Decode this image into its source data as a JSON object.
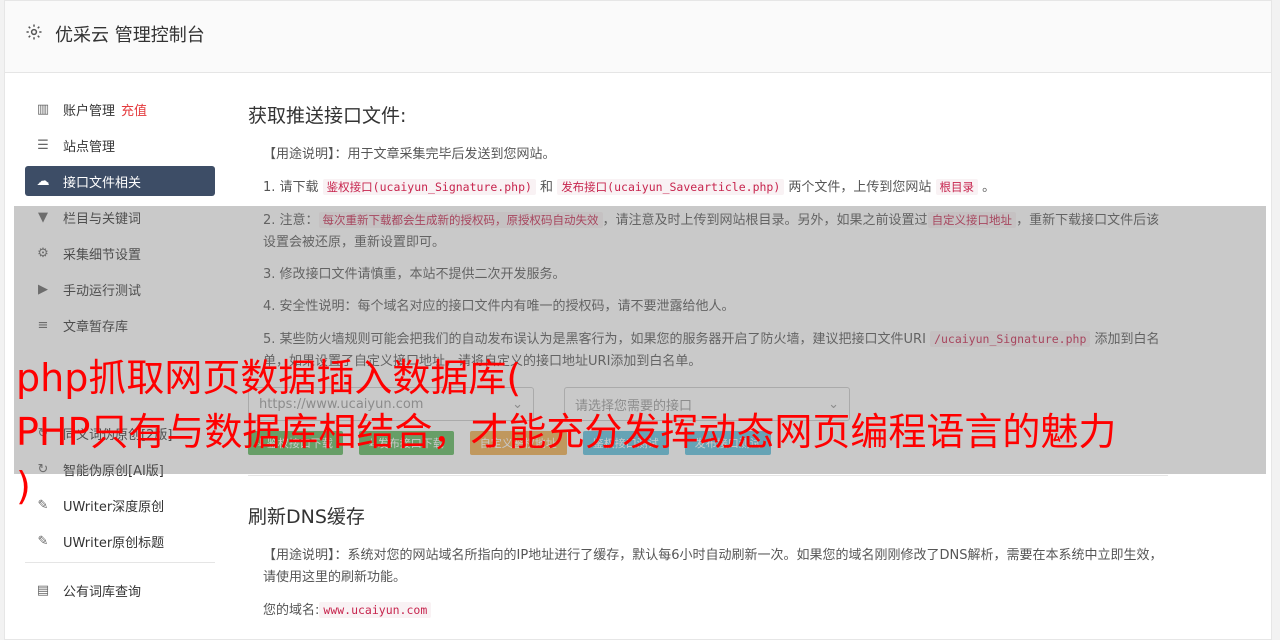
{
  "header": {
    "title": "优采云 管理控制台",
    "icon": "gear-icon"
  },
  "sidebar": {
    "items": [
      {
        "label": "账户管理",
        "badge": "充值",
        "icon": "bar-chart-icon"
      },
      {
        "label": "站点管理",
        "icon": "server-icon"
      },
      {
        "label": "接口文件相关",
        "icon": "cloud-upload-icon"
      },
      {
        "label": "栏目与关键词",
        "icon": "filter-icon"
      },
      {
        "label": "采集细节设置",
        "icon": "cogs-icon"
      },
      {
        "label": "手动运行测试",
        "icon": "play-circle-icon"
      },
      {
        "label": "文章暂存库",
        "icon": "database-icon"
      },
      {
        "label": "同义词伪原创[2版]",
        "icon": "refresh-icon"
      },
      {
        "label": "智能伪原创[AI版]",
        "icon": "refresh-icon"
      },
      {
        "label": "UWriter深度原创",
        "icon": "edit-icon"
      },
      {
        "label": "UWriter原创标题",
        "icon": "edit-icon"
      },
      {
        "label": "公有词库查询",
        "icon": "book-icon"
      }
    ]
  },
  "section1": {
    "title": "获取推送接口文件:",
    "usage_prefix": "【用途说明】",
    "usage_text": "：用于文章采集完毕后发送到您网站。",
    "item1": {
      "a": "1. 请下载 ",
      "code1": "鉴权接口(ucaiyun_Signature.php)",
      "b": " 和 ",
      "code2": "发布接口(ucaiyun_Savearticle.php)",
      "c": " 两个文件，上传到您网站 ",
      "code3": "根目录",
      "d": " 。"
    },
    "item2": {
      "a": "2. 注意：",
      "code1": "每次重新下载都会生成新的授权码，原授权码自动失效",
      "b": "，请注意及时上传到网站根目录。另外，如果之前设置过",
      "code2": "自定义接口地址",
      "c": "，重新下载接口文件后该设置会被还原，重新设置即可。"
    },
    "item3": "3. 修改接口文件请慎重，本站不提供二次开发服务。",
    "item4": "4. 安全性说明：每个域名对应的接口文件内有唯一的授权码，请不要泄露给他人。",
    "item5": {
      "a": "5. 某些防火墙规则可能会把我们的自动发布误认为是黑客行为，如果您的服务器开启了防火墙，建议把接口文件URI ",
      "code1": "/ucaiyun_Signature.php",
      "b": " 添加到白名单",
      "c": "，如果设置了自定义接口地址，请将自定义的接口地址URI添加到白名单。"
    },
    "select1": "https://www.ucaiyun.com",
    "select2": "请选择您需要的接口",
    "buttons": [
      "鉴权接口下载",
      "发布接口下载",
      "自定义鉴权地址",
      "鉴权接口测试",
      "发布接口测试"
    ]
  },
  "section2": {
    "title": "刷新DNS缓存",
    "usage_prefix": "【用途说明】",
    "usage_text": "：系统对您的网站域名所指向的IP地址进行了缓存，默认每6小时自动刷新一次。如果您的域名刚刚修改了DNS解析，需要在本系统中立即生效，请使用这里的刷新功能。",
    "domain_label": "您的域名:",
    "domain_value": "www.ucaiyun.com"
  },
  "watermark": {
    "line1": "php抓取网页数据插入数据库(",
    "line2": "PHP只有与数据库相结合，才能充分发挥动态网页编程语言的魅力",
    "line3": ")"
  },
  "colors": {
    "active_bg": "#3d4d66",
    "green": "#5cb85c",
    "orange": "#f0ad4e",
    "blue": "#5bc0de",
    "watermark": "#ff0000"
  }
}
